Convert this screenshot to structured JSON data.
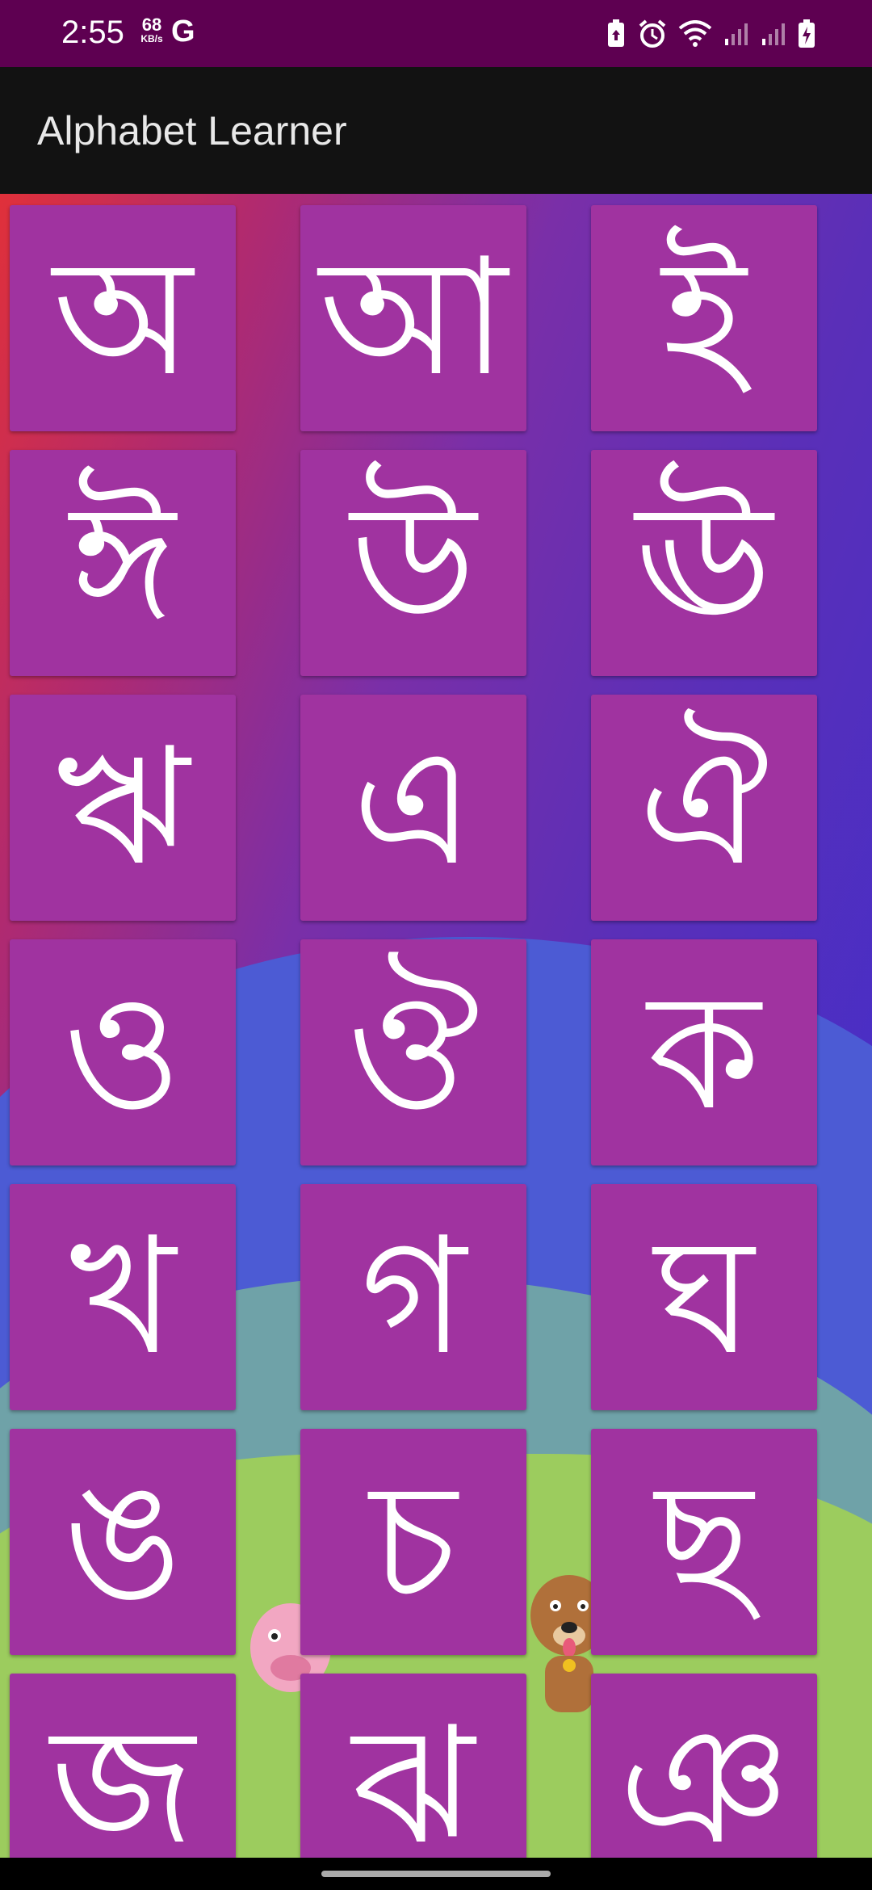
{
  "status_bar": {
    "time": "2:55",
    "net_speed_value": "68",
    "net_speed_unit": "KB/s",
    "google_glyph": "G",
    "icons": [
      "battery-saver-icon",
      "alarm-icon",
      "wifi-icon",
      "signal-icon",
      "signal-icon",
      "battery-charging-icon"
    ]
  },
  "app_bar": {
    "title": "Alphabet Learner"
  },
  "colors": {
    "status_bar": "#5e0051",
    "app_bar": "#121212",
    "tile": "#a033a0",
    "glyph": "#ffffff"
  },
  "letters": [
    "অ",
    "আ",
    "ই",
    "ঈ",
    "উ",
    "ঊ",
    "ঋ",
    "এ",
    "ঐ",
    "ও",
    "ঔ",
    "ক",
    "খ",
    "গ",
    "ঘ",
    "ঙ",
    "চ",
    "ছ",
    "জ",
    "ঝ",
    "ঞ"
  ]
}
